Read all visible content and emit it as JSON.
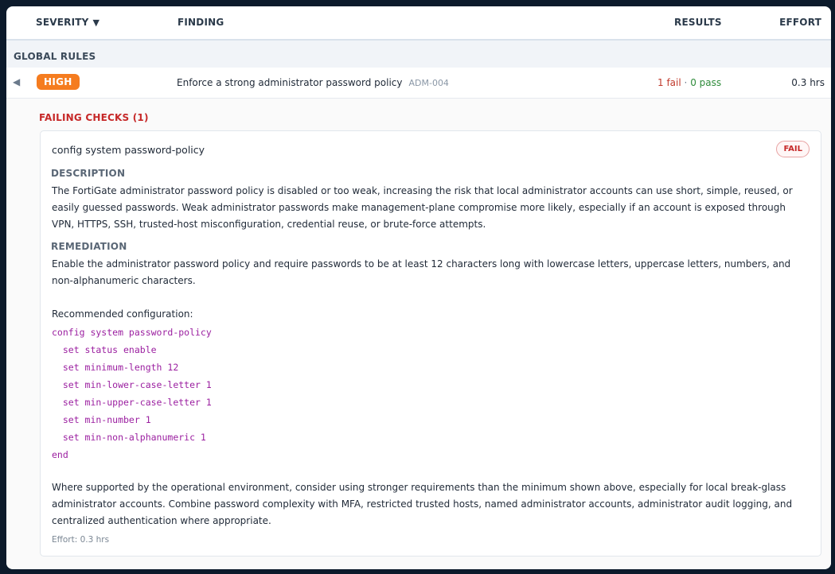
{
  "header": {
    "severity": "SEVERITY",
    "sort_caret": "▼",
    "finding": "FINDING",
    "results": "RESULTS",
    "effort": "EFFORT"
  },
  "group": {
    "label": "GLOBAL RULES"
  },
  "row": {
    "toggle_icon": "◀",
    "severity": "HIGH",
    "title": "Enforce a strong administrator password policy",
    "code": "ADM-004",
    "fail_text": "1 fail",
    "separator": "·",
    "pass_text": "0 pass",
    "effort": "0.3 hrs"
  },
  "detail": {
    "failing_title": "FAILING CHECKS (1)",
    "check_name": "config system password-policy",
    "status": "FAIL",
    "description_label": "DESCRIPTION",
    "description": "The FortiGate administrator password policy is disabled or too weak, increasing the risk that local administrator accounts can use short, simple, reused, or easily guessed passwords. Weak administrator passwords make management-plane compromise more likely, especially if an account is exposed through VPN, HTTPS, SSH, trusted-host misconfiguration, credential reuse, or brute-force attempts.",
    "remediation_label": "REMEDIATION",
    "remediation": "Enable the administrator password policy and require passwords to be at least 12 characters long with lowercase letters, uppercase letters, numbers, and non-alphanumeric characters.",
    "recommended_label": "Recommended configuration:",
    "config": "config system password-policy\n  set status enable\n  set minimum-length 12\n  set min-lower-case-letter 1\n  set min-upper-case-letter 1\n  set min-number 1\n  set min-non-alphanumeric 1\nend",
    "closing": "Where supported by the operational environment, consider using stronger requirements than the minimum shown above, especially for local break-glass administrator accounts. Combine password complexity with MFA, restricted trusted hosts, named administrator accounts, administrator audit logging, and centralized authentication where appropriate.",
    "effort_note": "Effort: 0.3 hrs"
  },
  "colors": {
    "high_badge": "#f57c1f",
    "fail": "#c62828",
    "pass": "#2e8b3a",
    "code": "#9b1fa0"
  }
}
